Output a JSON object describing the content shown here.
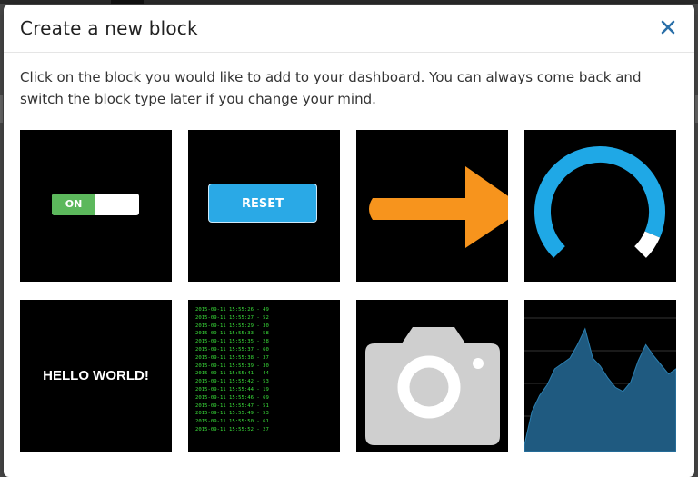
{
  "modal": {
    "title": "Create a new block",
    "description": "Click on the block you would like to add to your dashboard. You can always come back and switch the block type later if you change your mind."
  },
  "blocks": {
    "switch": {
      "label": "ON"
    },
    "button": {
      "label": "RESET"
    },
    "text": {
      "content": "HELLO WORLD!"
    },
    "log": {
      "lines": [
        "2015-09-11 15:55:26 - 49",
        "2015-09-11 15:55:27 - 52",
        "2015-09-11 15:55:29 - 30",
        "2015-09-11 15:55:33 - 58",
        "2015-09-11 15:55:35 - 28",
        "2015-09-11 15:55:37 - 60",
        "2015-09-11 15:55:38 - 37",
        "2015-09-11 15:55:39 - 30",
        "2015-09-11 15:55:41 - 44",
        "2015-09-11 15:55:42 - 53",
        "2015-09-11 15:55:44 - 19",
        "2015-09-11 15:55:46 - 69",
        "2015-09-11 15:55:47 - 51",
        "2015-09-11 15:55:49 - 53",
        "2015-09-11 15:55:50 - 61",
        "2015-09-11 15:55:52 - 27"
      ]
    },
    "gauge": {
      "fraction": 0.92
    },
    "chart": {
      "values": [
        5,
        30,
        42,
        50,
        62,
        66,
        70,
        80,
        92,
        70,
        64,
        55,
        48,
        45,
        52,
        68,
        80,
        72,
        65,
        58,
        62
      ]
    }
  },
  "colors": {
    "switch_on": "#5cb85c",
    "button": "#2aa9e6",
    "arrow": "#f7941d",
    "gauge": "#1fa8e6",
    "log_text": "#3adc3a",
    "chart_fill": "#1f5a80",
    "close_icon": "#2a6fa8"
  }
}
